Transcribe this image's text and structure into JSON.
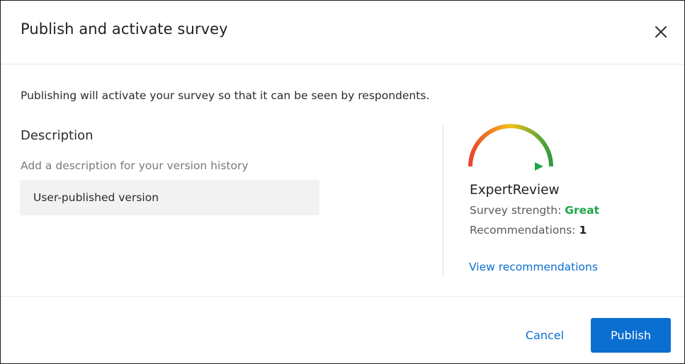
{
  "dialog": {
    "title": "Publish and activate survey",
    "close_icon": "close-icon"
  },
  "body": {
    "intro_text": "Publishing will activate your survey so that it can be seen by respondents.",
    "description": {
      "label": "Description",
      "hint": "Add a description for your version history",
      "value": "User-published version"
    }
  },
  "expert_review": {
    "gauge_icon": "gauge-icon",
    "title": "ExpertReview",
    "strength_label": "Survey strength:",
    "strength_value": "Great",
    "recommendations_label": "Recommendations:",
    "recommendations_count": "1",
    "view_link": "View recommendations"
  },
  "footer": {
    "cancel_label": "Cancel",
    "publish_label": "Publish"
  },
  "colors": {
    "accent": "#0b6fd1",
    "great": "#1fa64a",
    "gauge_red": "#e8452f",
    "gauge_yellow": "#f2c11a",
    "gauge_green": "#2f9a3f"
  }
}
